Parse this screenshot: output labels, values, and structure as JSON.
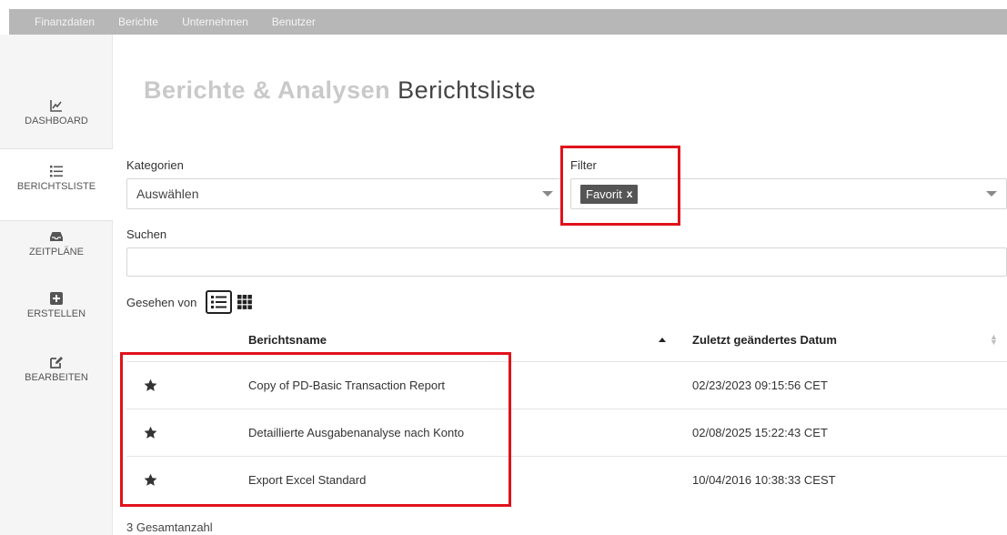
{
  "topnav": [
    "Finanzdaten",
    "Berichte",
    "Unternehmen",
    "Benutzer"
  ],
  "sidebar": {
    "items": [
      {
        "label": "DASHBOARD",
        "icon": "chart-icon"
      },
      {
        "label": "BERICHTSLISTE",
        "icon": "list-icon",
        "active": true
      },
      {
        "label": "ZEITPLÄNE",
        "icon": "inbox-icon"
      },
      {
        "label": "ERSTELLEN",
        "icon": "plus-square-icon"
      },
      {
        "label": "BEARBEITEN",
        "icon": "edit-icon"
      }
    ]
  },
  "page": {
    "title_strong": "Berichte & Analysen",
    "title_light": "Berichtsliste"
  },
  "filters": {
    "kategorien_label": "Kategorien",
    "kategorien_value": "Auswählen",
    "filter_label": "Filter",
    "filter_tag": "Favorit",
    "filter_tag_remove": "x",
    "suchen_label": "Suchen",
    "suchen_value": ""
  },
  "view": {
    "label": "Gesehen von"
  },
  "table": {
    "columns": [
      "Berichtsname",
      "Zuletzt geändertes Datum"
    ],
    "rows": [
      {
        "favorite": true,
        "name": "Copy of PD-Basic Transaction Report",
        "date": "02/23/2023 09:15:56 CET"
      },
      {
        "favorite": true,
        "name": "Detaillierte Ausgabenanalyse nach Konto",
        "date": "02/08/2025 15:22:43 CET"
      },
      {
        "favorite": true,
        "name": "Export Excel Standard",
        "date": "10/04/2016 10:38:33 CEST"
      }
    ],
    "total": "3 Gesamtanzahl"
  },
  "colors": {
    "highlight": "#e0121b",
    "topbar": "#b7b7b7",
    "sidebar": "#f5f5f5"
  }
}
